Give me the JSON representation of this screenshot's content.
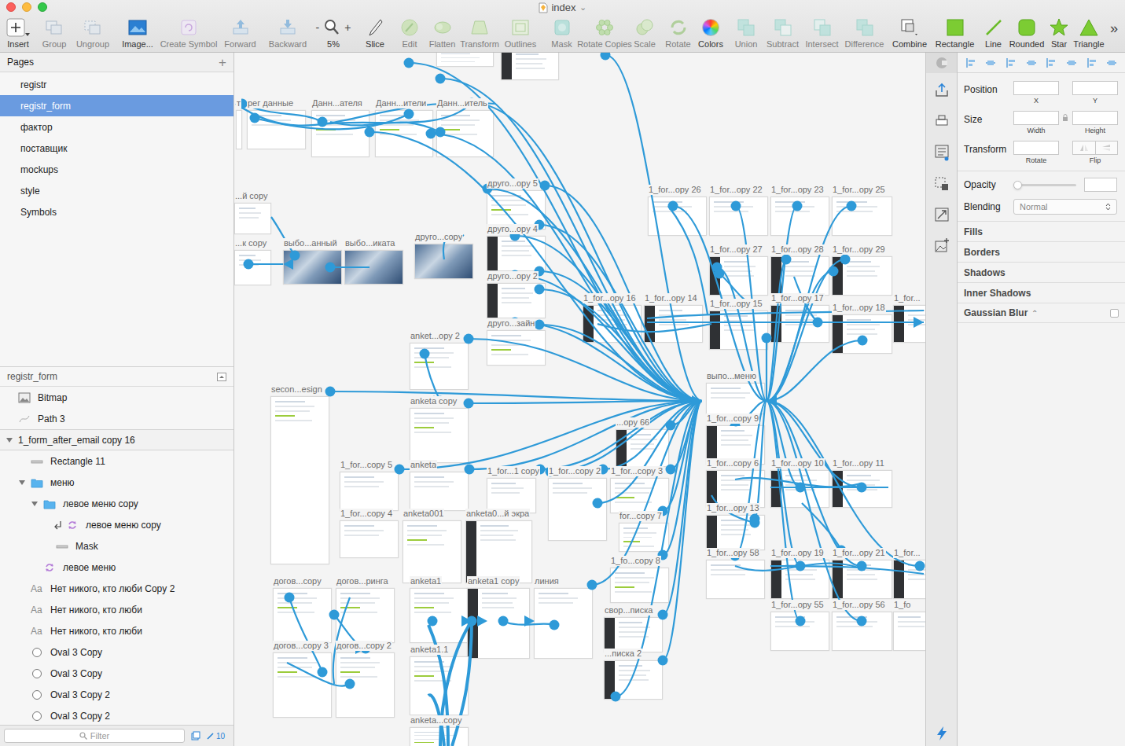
{
  "window": {
    "title": "index",
    "title_caret": "⌄"
  },
  "toolbar": [
    {
      "label": "Insert",
      "kind": "insert",
      "disabled": false
    },
    {
      "label": "Group",
      "kind": "group",
      "disabled": true
    },
    {
      "label": "Ungroup",
      "kind": "ungroup",
      "disabled": true
    },
    {
      "label": "Image...",
      "kind": "image",
      "disabled": false
    },
    {
      "label": "Create Symbol",
      "kind": "symbol",
      "disabled": true
    },
    {
      "label": "Forward",
      "kind": "forward",
      "disabled": true
    },
    {
      "label": "Backward",
      "kind": "backward",
      "disabled": true
    },
    {
      "label": "5%",
      "kind": "zoom",
      "disabled": false,
      "minus": "-",
      "plus": "+"
    },
    {
      "label": "Slice",
      "kind": "slice",
      "disabled": false
    },
    {
      "label": "Edit",
      "kind": "edit",
      "disabled": true
    },
    {
      "label": "Flatten",
      "kind": "flatten",
      "disabled": true
    },
    {
      "label": "Transform",
      "kind": "transform",
      "disabled": true
    },
    {
      "label": "Outlines",
      "kind": "outlines",
      "disabled": true
    },
    {
      "label": "Mask",
      "kind": "mask",
      "disabled": true
    },
    {
      "label": "Rotate Copies",
      "kind": "rotatecopies",
      "disabled": true
    },
    {
      "label": "Scale",
      "kind": "scale",
      "disabled": true
    },
    {
      "label": "Rotate",
      "kind": "rotate",
      "disabled": true
    },
    {
      "label": "Colors",
      "kind": "colors",
      "disabled": false
    },
    {
      "label": "Union",
      "kind": "union",
      "disabled": true
    },
    {
      "label": "Subtract",
      "kind": "subtract",
      "disabled": true
    },
    {
      "label": "Intersect",
      "kind": "intersect",
      "disabled": true
    },
    {
      "label": "Difference",
      "kind": "difference",
      "disabled": true
    },
    {
      "label": "Combine",
      "kind": "combine",
      "disabled": false
    },
    {
      "label": "Rectangle",
      "kind": "rectangle",
      "disabled": false
    },
    {
      "label": "Line",
      "kind": "line",
      "disabled": false
    },
    {
      "label": "Rounded",
      "kind": "rounded",
      "disabled": false
    },
    {
      "label": "Star",
      "kind": "star",
      "disabled": false
    },
    {
      "label": "Triangle",
      "kind": "triangle",
      "disabled": false
    },
    {
      "label": "»",
      "kind": "more",
      "disabled": false
    }
  ],
  "pages": {
    "title": "Pages",
    "add": "+",
    "items": [
      {
        "label": "registr",
        "selected": false
      },
      {
        "label": "registr_form",
        "selected": true
      },
      {
        "label": "фактор",
        "selected": false
      },
      {
        "label": "поставщик",
        "selected": false
      },
      {
        "label": "mockups",
        "selected": false
      },
      {
        "label": "style",
        "selected": false
      },
      {
        "label": "Symbols",
        "selected": false
      }
    ]
  },
  "layers": {
    "title": "registr_form",
    "items": [
      {
        "label": "Bitmap",
        "kind": "bitmap",
        "depth": 0,
        "expanded": false,
        "masked": false
      },
      {
        "label": "Path 3",
        "kind": "path",
        "depth": 0,
        "expanded": false,
        "masked": false
      },
      {
        "label": "1_form_after_email copy 16",
        "kind": "artboard",
        "depth": 0,
        "expanded": true,
        "masked": false
      },
      {
        "label": "Rectangle 11",
        "kind": "rect",
        "depth": 1,
        "expanded": false,
        "masked": false
      },
      {
        "label": "меню",
        "kind": "group",
        "depth": 1,
        "expanded": true,
        "masked": false
      },
      {
        "label": "левое меню copy",
        "kind": "group",
        "depth": 2,
        "expanded": true,
        "masked": false
      },
      {
        "label": "левое меню copy",
        "kind": "symbol",
        "depth": 3,
        "expanded": false,
        "masked": true
      },
      {
        "label": "Mask",
        "kind": "mask",
        "depth": 3,
        "expanded": false,
        "masked": false
      },
      {
        "label": "левое меню",
        "kind": "symbol",
        "depth": 2,
        "expanded": false,
        "masked": false
      },
      {
        "label": "Нет никого, кто люби Copy 2",
        "kind": "text",
        "icon_text": "Aa",
        "depth": 1,
        "expanded": false,
        "masked": false
      },
      {
        "label": "Нет никого, кто люби",
        "kind": "text",
        "icon_text": "Aa",
        "depth": 1,
        "expanded": false,
        "masked": false
      },
      {
        "label": "Нет никого, кто люби",
        "kind": "text",
        "icon_text": "Aa",
        "depth": 1,
        "expanded": false,
        "masked": false
      },
      {
        "label": "Oval 3 Copy",
        "kind": "oval",
        "depth": 1,
        "expanded": false,
        "masked": false
      },
      {
        "label": "Oval 3 Copy",
        "kind": "oval",
        "depth": 1,
        "expanded": false,
        "masked": false
      },
      {
        "label": "Oval 3 Copy 2",
        "kind": "oval",
        "depth": 1,
        "expanded": false,
        "masked": false
      },
      {
        "label": "Oval 3 Copy 2",
        "kind": "oval",
        "depth": 1,
        "expanded": false,
        "masked": false
      }
    ]
  },
  "filter": {
    "placeholder": "Filter",
    "count": "10"
  },
  "canvas": {
    "artboards": [
      {
        "label": "рег данные",
        "kind": "white"
      },
      {
        "label": "Данн...ателя",
        "kind": "list"
      },
      {
        "label": "Данн...ители",
        "kind": "list"
      },
      {
        "label": "Данн...итель",
        "kind": "list"
      },
      {
        "label": "т",
        "kind": "white"
      },
      {
        "label": "",
        "kind": "white"
      },
      {
        "label": "",
        "kind": "dark"
      },
      {
        "label": "...й copy",
        "kind": "white"
      },
      {
        "label": "...к copy",
        "kind": "white"
      },
      {
        "label": "выбо...анный",
        "kind": "photo"
      },
      {
        "label": "выбо...иката",
        "kind": "photo"
      },
      {
        "label": "друго...copy",
        "kind": "photo"
      },
      {
        "label": "друго...opy 5",
        "kind": "list"
      },
      {
        "label": "друго...opy 4",
        "kind": "dark"
      },
      {
        "label": "друго...opy 2",
        "kind": "dark"
      },
      {
        "label": "друго...зайн",
        "kind": "list"
      },
      {
        "label": "anket...opy 2",
        "kind": "list"
      },
      {
        "label": "anketa copy",
        "kind": "list"
      },
      {
        "label": "secon...esign",
        "kind": "list"
      },
      {
        "label": "1_for...copy 5",
        "kind": "white"
      },
      {
        "label": "1_for...copy 4",
        "kind": "white"
      },
      {
        "label": "anketa",
        "kind": "white"
      },
      {
        "label": "anketa001",
        "kind": "list"
      },
      {
        "label": "anketa0...й экра",
        "kind": "dark"
      },
      {
        "label": "1_for...1 copy",
        "kind": "white"
      },
      {
        "label": "1_for...copy 2",
        "kind": "white"
      },
      {
        "label": "1_for...copy 3",
        "kind": "list"
      },
      {
        "label": "for...copy 7",
        "kind": "list"
      },
      {
        "label": "1_fo...copy 8",
        "kind": "list"
      },
      {
        "label": "...opy 66",
        "kind": "dark"
      },
      {
        "label": "догов...copy",
        "kind": "list"
      },
      {
        "label": "догов...ринга",
        "kind": "list"
      },
      {
        "label": "anketa1",
        "kind": "list"
      },
      {
        "label": "anketa1 copy",
        "kind": "dark"
      },
      {
        "label": "линия",
        "kind": "white"
      },
      {
        "label": "догов...copy 3",
        "kind": "list"
      },
      {
        "label": "догов...copy 2",
        "kind": "list"
      },
      {
        "label": "anketa1.1",
        "kind": "list"
      },
      {
        "label": "anketa...copy",
        "kind": "list"
      },
      {
        "label": "свор...писка",
        "kind": "dark"
      },
      {
        "label": "...писка 2",
        "kind": "dark"
      },
      {
        "label": "1_for...opy 26",
        "kind": "white"
      },
      {
        "label": "1_for...opy 22",
        "kind": "white"
      },
      {
        "label": "1_for...opy 23",
        "kind": "white"
      },
      {
        "label": "1_for...opy 25",
        "kind": "white"
      },
      {
        "label": "1_for...opy 27",
        "kind": "dark"
      },
      {
        "label": "1_for...opy 28",
        "kind": "dark"
      },
      {
        "label": "1_for...opy 29",
        "kind": "dark"
      },
      {
        "label": "1_for...opy 16",
        "kind": "dark"
      },
      {
        "label": "1_for...opy 14",
        "kind": "dark"
      },
      {
        "label": "1_for...opy 15",
        "kind": "dark"
      },
      {
        "label": "1_for...opy 17",
        "kind": "dark"
      },
      {
        "label": "1_for...opy 18",
        "kind": "dark"
      },
      {
        "label": "1_for...",
        "kind": "dark"
      },
      {
        "label": "выпо...меню",
        "kind": "white"
      },
      {
        "label": "1_for...copy 9",
        "kind": "dark"
      },
      {
        "label": "1_for...copy 6",
        "kind": "dark"
      },
      {
        "label": "1_for...opy 10",
        "kind": "dark"
      },
      {
        "label": "1_for...opy 11",
        "kind": "dark"
      },
      {
        "label": "1_for...opy 13",
        "kind": "dark"
      },
      {
        "label": "1_for...opy 58",
        "kind": "white"
      },
      {
        "label": "1_for...opy 19",
        "kind": "dark"
      },
      {
        "label": "1_for...opy 21",
        "kind": "dark"
      },
      {
        "label": "1_for...",
        "kind": "dark"
      },
      {
        "label": "1_for...opy 55",
        "kind": "white"
      },
      {
        "label": "1_for...opy 56",
        "kind": "white"
      },
      {
        "label": "1_fo",
        "kind": "white"
      }
    ]
  },
  "inspector": {
    "position": {
      "label": "Position",
      "x": "X",
      "y": "Y"
    },
    "size": {
      "label": "Size",
      "width": "Width",
      "height": "Height"
    },
    "transform": {
      "label": "Transform",
      "rotate": "Rotate",
      "flip": "Flip"
    },
    "opacity": {
      "label": "Opacity",
      "level": 0
    },
    "blending": {
      "label": "Blending",
      "value": "Normal"
    },
    "sections": [
      {
        "label": "Fills"
      },
      {
        "label": "Borders"
      },
      {
        "label": "Shadows"
      },
      {
        "label": "Inner Shadows"
      }
    ],
    "blur": {
      "label": "Gaussian Blur",
      "stepper": "⌃",
      "checked": false
    }
  }
}
